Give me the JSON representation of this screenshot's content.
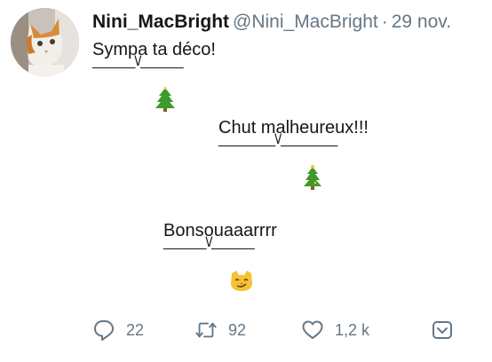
{
  "author": {
    "display_name": "Nini_MacBright",
    "handle": "@Nini_MacBright",
    "separator": "·",
    "date": "29 nov."
  },
  "blocks": [
    {
      "text": "Sympa ta déco!",
      "line": "______\\/______",
      "emoji": "christmas-tree-emoji"
    },
    {
      "text": "Chut malheureux!!!",
      "line": "________\\/________",
      "emoji": "christmas-tree-emoji"
    },
    {
      "text": "Bonsouaaarrrr",
      "line": "______\\/______",
      "emoji": "smirking-cat-emoji"
    }
  ],
  "actions": {
    "reply_count": "22",
    "retweet_count": "92",
    "like_count": "1,2 k"
  },
  "colors": {
    "text": "#14171a",
    "muted": "#657786",
    "tree_green": "#3e9a2b",
    "cat_yellow": "#f7c132"
  }
}
